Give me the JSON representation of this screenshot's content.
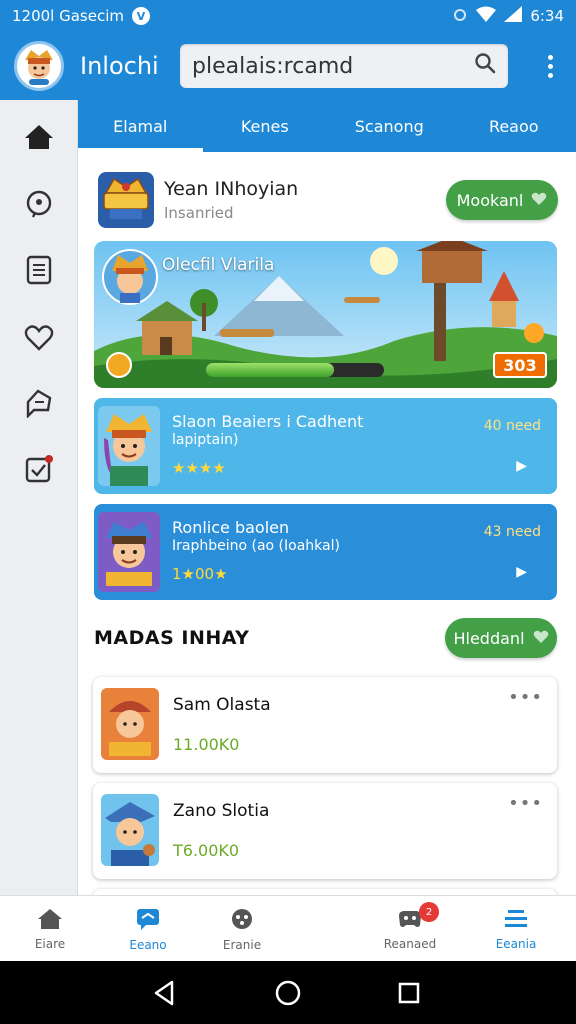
{
  "status_bar": {
    "left_text": "1200l Gasecim",
    "time": "6:34"
  },
  "app_bar": {
    "title": "Inlochi",
    "search_value": "plealais:rcamd"
  },
  "tabs": [
    {
      "label": "Elamal",
      "active": true
    },
    {
      "label": "Kenes",
      "active": false
    },
    {
      "label": "Scanong",
      "active": false
    },
    {
      "label": "Reaoo",
      "active": false
    }
  ],
  "game": {
    "title": "Yean INhoyian",
    "subtitle": "Insanried",
    "follow_label": "Mookanl"
  },
  "banner": {
    "title": "Olecfil Vlarila",
    "badge": "303",
    "progress": 0.72
  },
  "characters": [
    {
      "name": "Slaon Beaiers i Cadhent",
      "desc": "lapiptain)",
      "stars": "★★★★",
      "need": "40 need"
    },
    {
      "name": "Ronlice baolen",
      "desc": "Iraphbeino (ao (Ioahkal)",
      "stars": "1★00★",
      "need": "43 need"
    }
  ],
  "section": {
    "title": "MADAS INHAY",
    "button_label": "Hleddanl"
  },
  "players": [
    {
      "name": "Sam Olasta",
      "score": "11.00K0"
    },
    {
      "name": "Zano Slotia",
      "score": "T6.00K0"
    }
  ],
  "bottom_nav": [
    {
      "label": "Eiare",
      "icon": "home-icon",
      "active": false
    },
    {
      "label": "Eeano",
      "icon": "chat-icon",
      "active": true
    },
    {
      "label": "Eranie",
      "icon": "gamepad-icon",
      "active": false
    },
    {
      "label": "Reanaed",
      "icon": "controller-icon",
      "active": false,
      "badge": "2"
    },
    {
      "label": "Eeania",
      "icon": "list-icon",
      "active": true
    }
  ],
  "colors": {
    "primary": "#1e88d6",
    "green": "#43a047",
    "card_light": "#4fb6e9",
    "card_dark": "#2a8ed9"
  }
}
